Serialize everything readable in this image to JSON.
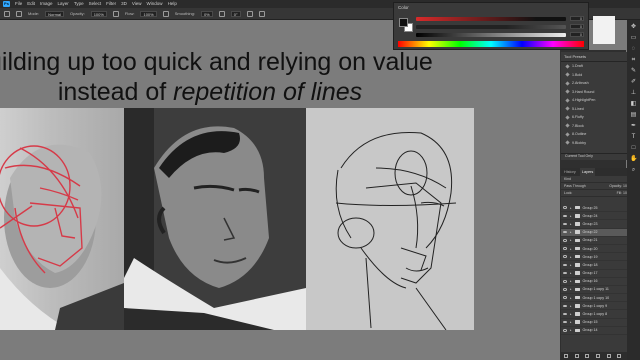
{
  "menubar": {
    "items": [
      "File",
      "Edit",
      "Image",
      "Layer",
      "Type",
      "Select",
      "Filter",
      "3D",
      "View",
      "Window",
      "Help"
    ]
  },
  "options": {
    "mode_label": "Mode:",
    "mode_value": "Normal",
    "opacity_label": "Opacity:",
    "opacity_value": "100%",
    "flow_label": "Flow:",
    "flow_value": "100%",
    "smoothing_label": "Smoothing:",
    "smoothing_value": "0%",
    "angle_value": "0°"
  },
  "slide": {
    "line1": "uilding up too quick and relying on value",
    "line2_prefix": "instead of ",
    "line2_italic": "repetition of lines"
  },
  "color_panel": {
    "title": "Color",
    "values": [
      "0",
      "0",
      "0"
    ]
  },
  "tool_presets": {
    "title": "Tool Presets",
    "items": [
      "1.Draft",
      "1.Bold",
      "2.Artbrush",
      "3.Hard Round",
      "4.HighlightPen",
      "5.Lined",
      "6.Fluffy",
      "7.Block",
      "8.Outline",
      "9.Blobby"
    ],
    "footer": "Current Tool Only"
  },
  "layers": {
    "tabs": [
      "History",
      "Layers"
    ],
    "kind_label": "Kind",
    "blend_mode": "Pass Through",
    "opacity_label": "Opacity:",
    "opacity_value": "100%",
    "lock_label": "Lock:",
    "fill_label": "Fill:",
    "fill_value": "100%",
    "items": [
      {
        "name": "Group 25"
      },
      {
        "name": "Group 24"
      },
      {
        "name": "Group 23"
      },
      {
        "name": "Group 22"
      },
      {
        "name": "Group 21"
      },
      {
        "name": "Group 20"
      },
      {
        "name": "Group 19"
      },
      {
        "name": "Group 18"
      },
      {
        "name": "Group 17"
      },
      {
        "name": "Group 16"
      },
      {
        "name": "Group 1 copy 11"
      },
      {
        "name": "Group 1 copy 10"
      },
      {
        "name": "Group 1 copy 9"
      },
      {
        "name": "Group 1 copy 8"
      },
      {
        "name": "Group 15"
      },
      {
        "name": "Group 14"
      }
    ],
    "active_index": 3
  },
  "icons": {
    "tools": [
      "move-icon",
      "marquee-icon",
      "lasso-icon",
      "crop-icon",
      "eyedropper-icon",
      "brush-icon",
      "stamp-icon",
      "eraser-icon",
      "gradient-icon",
      "pen-icon",
      "type-icon",
      "shape-icon",
      "hand-icon",
      "zoom-icon"
    ]
  }
}
